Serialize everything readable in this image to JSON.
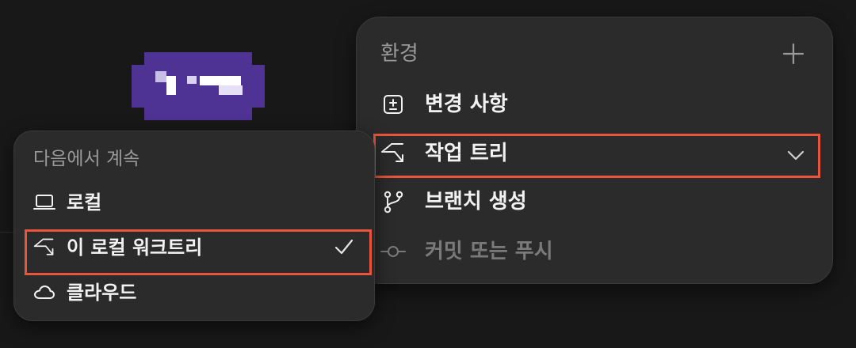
{
  "env_menu": {
    "title": "환경",
    "items": [
      {
        "label": "변경 사항",
        "icon": "diff-icon"
      },
      {
        "label": "작업 트리",
        "icon": "worktree-icon",
        "highlighted": true,
        "has_chevron": true
      },
      {
        "label": "브랜치 생성",
        "icon": "branch-icon"
      },
      {
        "label": "커밋 또는 푸시",
        "icon": "commit-icon",
        "disabled": true
      }
    ]
  },
  "continue_menu": {
    "title": "다음에서 계속",
    "items": [
      {
        "label": "로컬",
        "icon": "laptop-icon"
      },
      {
        "label": "이 로컬 워크트리",
        "icon": "worktree-icon",
        "selected": true,
        "highlighted": true
      },
      {
        "label": "클라우드",
        "icon": "cloud-icon"
      }
    ]
  },
  "colors": {
    "background": "#181818",
    "panel": "#2b2b2b",
    "highlight_border": "#e8553b",
    "logo_purple": "#4e3294",
    "text": "#f2f2f2",
    "muted_text": "#9a9a9a"
  }
}
